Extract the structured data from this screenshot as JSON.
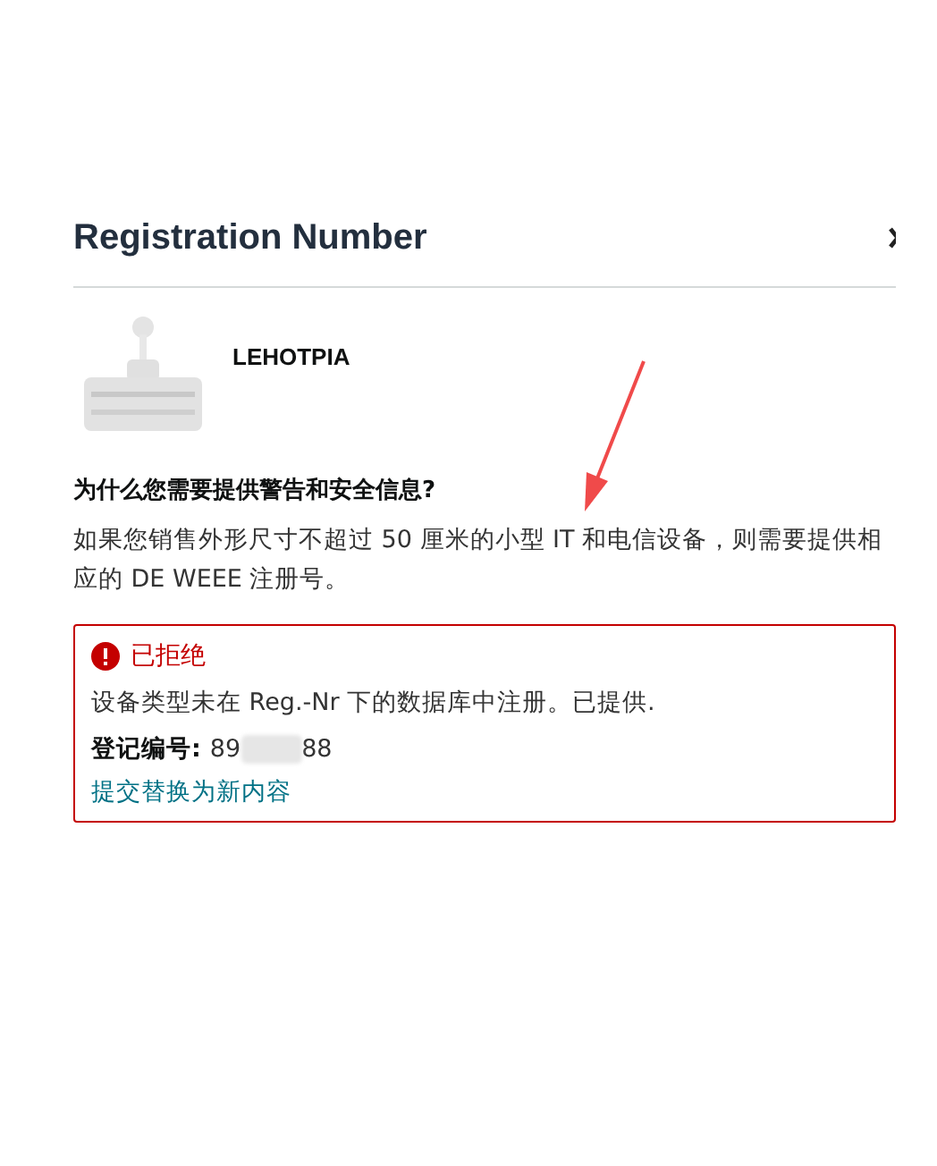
{
  "title": "Registration Number",
  "product": {
    "brand": "LEHOTPIA"
  },
  "info": {
    "heading": "为什么您需要提供警告和安全信息?",
    "text": "如果您销售外形尺寸不超过 50 厘米的小型 IT 和电信设备，则需要提供相应的 DE WEEE 注册号。"
  },
  "status": {
    "kind": "rejected",
    "label": "已拒绝",
    "message": "设备类型未在 Reg.-Nr 下的数据库中注册。已提供.",
    "field_label": "登记编号:",
    "value_start": "89",
    "value_end": "88",
    "link": "提交替换为新内容"
  }
}
